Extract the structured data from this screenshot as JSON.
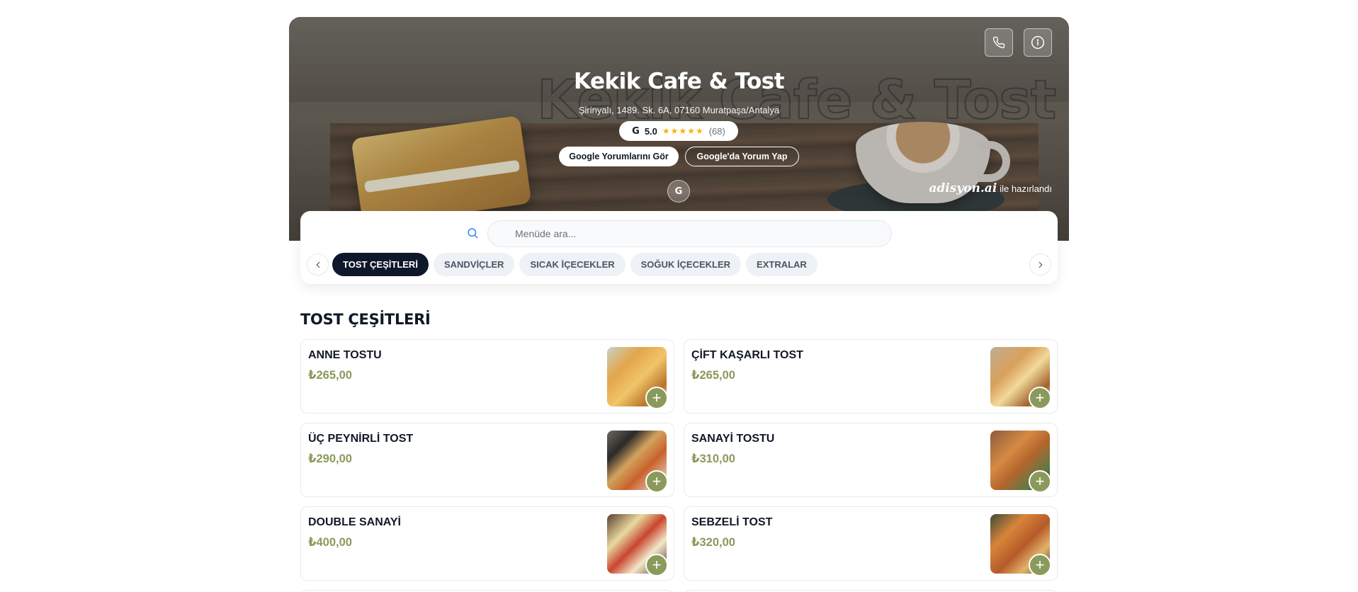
{
  "header": {
    "title": "Kekik Cafe & Tost",
    "address": "Şirinyalı, 1489. Sk. 6A, 07160 Muratpaşa/Antalya",
    "rating": {
      "score": "5.0",
      "stars": "★★★★★",
      "count": "(68)",
      "google_mark": "G"
    },
    "reviews_button": "Google Yorumlarını Gör",
    "write_review_button": "Google'da Yorum Yap",
    "google_circle": "G",
    "powered_by_brand": "adisyon.ai",
    "powered_by_suffix": "ile hazırlandı",
    "icons": [
      "phone-icon",
      "info-icon"
    ]
  },
  "search": {
    "placeholder": "Menüde ara..."
  },
  "categories": [
    {
      "label": "TOST ÇEŞİTLERİ",
      "active": true
    },
    {
      "label": "SANDVİÇLER",
      "active": false
    },
    {
      "label": "SICAK İÇECEKLER",
      "active": false
    },
    {
      "label": "SOĞUK İÇECEKLER",
      "active": false
    },
    {
      "label": "EXTRALAR",
      "active": false
    }
  ],
  "section": {
    "title": "TOST ÇEŞİTLERİ",
    "items": [
      {
        "name": "ANNE TOSTU",
        "price": "₺265,00"
      },
      {
        "name": "ÇİFT KAŞARLI TOST",
        "price": "₺265,00"
      },
      {
        "name": "ÜÇ PEYNİRLİ TOST",
        "price": "₺290,00"
      },
      {
        "name": "SANAYİ TOSTU",
        "price": "₺310,00"
      },
      {
        "name": "DOUBLE SANAYİ",
        "price": "₺400,00"
      },
      {
        "name": "SEBZELİ TOST",
        "price": "₺320,00"
      }
    ]
  },
  "colors": {
    "accent_price": "#8a9a5b",
    "active_tab": "#0f172a",
    "star": "#f5b400"
  }
}
